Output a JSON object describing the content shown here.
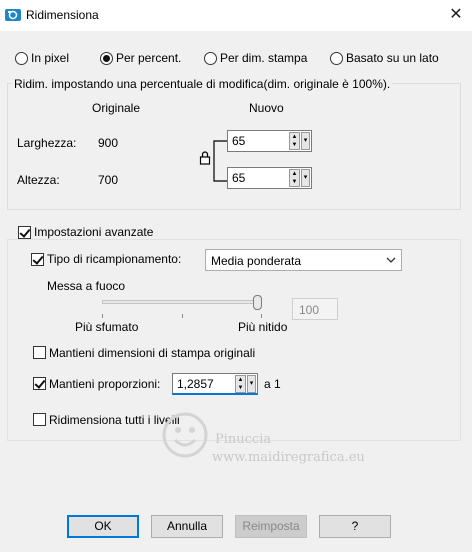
{
  "window": {
    "title": "Ridimensiona",
    "close_glyph": "✕",
    "app_icon": "resize-app-icon"
  },
  "mode_options": [
    {
      "label": "In pixel",
      "selected": false
    },
    {
      "label": "Per percent.",
      "selected": true
    },
    {
      "label": "Per dim. stampa",
      "selected": false
    },
    {
      "label": "Basato su un lato",
      "selected": false
    }
  ],
  "percent_group": {
    "caption": "Ridim. impostando una percentuale di modifica(dim. originale è 100%).",
    "col_original": "Originale",
    "col_new": "Nuovo",
    "width_label": "Larghezza:",
    "width_original": "900",
    "width_new": "65",
    "height_label": "Altezza:",
    "height_original": "700",
    "height_new": "65"
  },
  "advanced": {
    "label": "Impostazioni avanzate",
    "checked": true,
    "resample_label": "Tipo di ricampionamento:",
    "resample_checked": true,
    "resample_value": "Media ponderata",
    "sharpness_label": "Messa a fuoco",
    "sharpness_value": "100",
    "sharpness_min_label": "Più sfumato",
    "sharpness_max_label": "Più nitido",
    "sharpness_level": 1.0,
    "keep_print_label": "Mantieni dimensioni di stampa originali",
    "keep_print_checked": false,
    "keep_ratio_label": "Mantieni proporzioni:",
    "keep_ratio_checked": true,
    "ratio_value": "1,2857",
    "ratio_suffix": "a 1",
    "resize_all_label": "Ridimensiona tutti i livelli",
    "resize_all_checked": false
  },
  "watermark": {
    "line1": "Pinuccia",
    "line2": "www.maidiregrafica.eu"
  },
  "buttons": {
    "ok": "OK",
    "cancel": "Annulla",
    "reset": "Reimposta",
    "help": "?"
  }
}
